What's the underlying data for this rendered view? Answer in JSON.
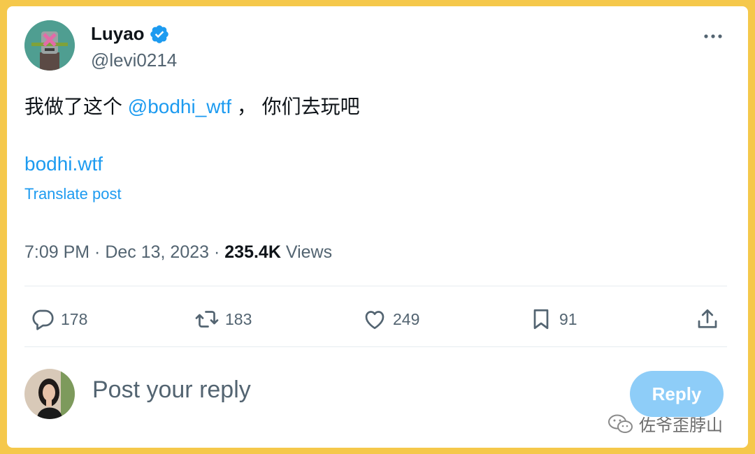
{
  "colors": {
    "accent": "#1d9bf0",
    "frame": "#f5c84b",
    "muted": "#536471",
    "reply_button_bg": "#8ecdf8"
  },
  "post": {
    "author_name": "Luyao",
    "verified": true,
    "handle": "@levi0214",
    "text_before_mention": "我做了这个 ",
    "mention": "@bodhi_wtf",
    "text_after_mention": " ， 你们去玩吧",
    "link": "bodhi.wtf",
    "translate_label": "Translate post",
    "time": "7:09 PM",
    "date": "Dec 13, 2023",
    "views_count": "235.4K",
    "views_label": "Views"
  },
  "actions": {
    "replies": "178",
    "reposts": "183",
    "likes": "249",
    "bookmarks": "91"
  },
  "icons": [
    "verified-badge-icon",
    "more-icon",
    "reply-icon",
    "repost-icon",
    "like-icon",
    "bookmark-icon",
    "share-icon",
    "wechat-icon"
  ],
  "reply_box": {
    "placeholder": "Post your reply",
    "button_label": "Reply"
  },
  "watermark": {
    "text": "佐爷歪脖山"
  }
}
